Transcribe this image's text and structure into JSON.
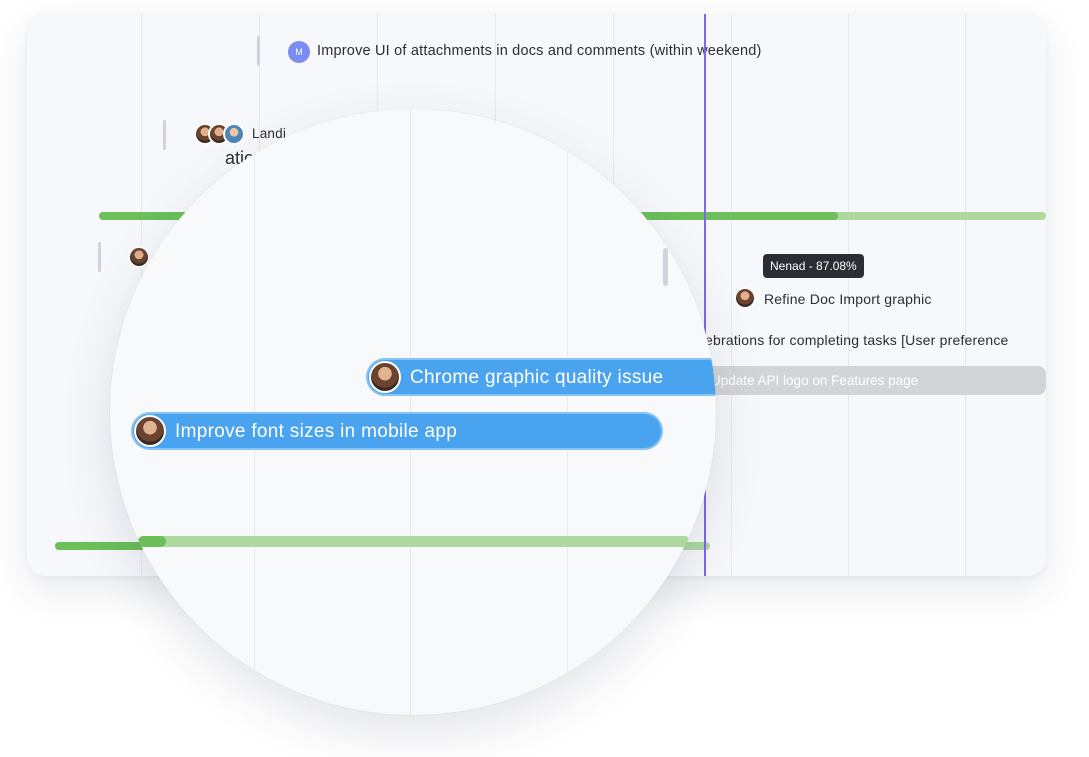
{
  "colors": {
    "today_line": "#7b68ee",
    "progress_fill": "#6cbf59",
    "progress_track": "#add9a0",
    "task_pill": "#49a3ee",
    "tooltip_bg": "#2a2d33",
    "muted_bar": "#d3d4d8"
  },
  "tasks": {
    "attachments_ui": {
      "avatar_initial": "M",
      "label": "Improve UI of attachments in docs and comments (within weekend)"
    },
    "landing": {
      "label": "Landi"
    },
    "partial_title": "ations",
    "refine_doc": {
      "label": "Refine Doc Import graphic"
    },
    "celebrations": {
      "label": "ebrations for completing tasks [User preference"
    },
    "update_api": {
      "label": "Update API logo on Features page"
    }
  },
  "tooltip": {
    "text": "Nenad - 87.08%"
  },
  "progress": {
    "top_bar_fill": 0.78,
    "lens_bar_fill": 0.05,
    "bottom_bar_fill": 0.9
  },
  "magnifier": {
    "chrome_task": {
      "label": "Chrome graphic quality issue"
    },
    "font_task": {
      "label": "Improve font sizes in mobile app"
    }
  }
}
